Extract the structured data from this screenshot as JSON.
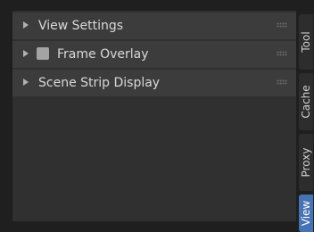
{
  "panels": [
    {
      "label": "View Settings",
      "has_checkbox": false,
      "collapsed": true
    },
    {
      "label": "Frame Overlay",
      "has_checkbox": true,
      "collapsed": true
    },
    {
      "label": "Scene Strip Display",
      "has_checkbox": false,
      "collapsed": true
    }
  ],
  "tabs": [
    {
      "label": "Tool",
      "active": false
    },
    {
      "label": "Cache",
      "active": false
    },
    {
      "label": "Proxy",
      "active": false
    },
    {
      "label": "View",
      "active": true
    }
  ],
  "colors": {
    "background": "#1f1f1f",
    "panel_area": "#303030",
    "panel_header": "#3c3c3c",
    "active_tab": "#4772b3",
    "text": "#d9d9d9"
  },
  "icons": {
    "expand_arrow": "disclosure-triangle-right-icon",
    "drag_handle": "grip-dots-icon"
  }
}
